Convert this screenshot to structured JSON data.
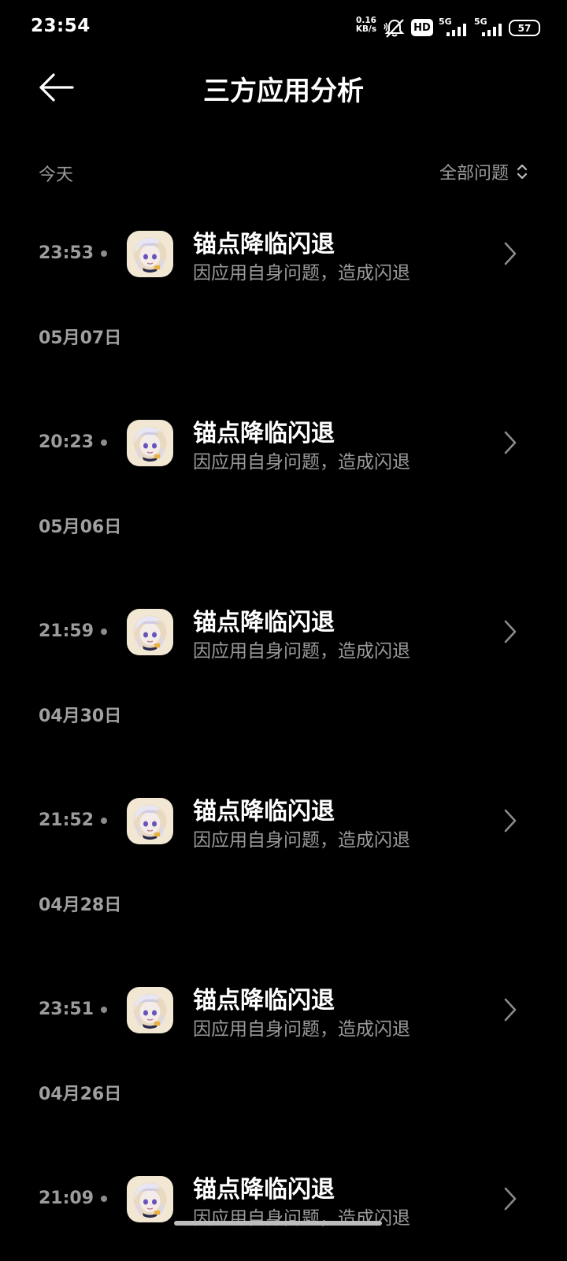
{
  "status_bar": {
    "time": "23:54",
    "net_speed_value": "0.16",
    "net_speed_unit": "KB/s",
    "hd_badge": "HD",
    "signal1_label": "5G",
    "signal2_label": "5G",
    "battery_level": "57",
    "icons": [
      "mute-icon",
      "hd-icon",
      "signal-5g-icon",
      "signal-5g-icon-2",
      "battery-icon"
    ]
  },
  "header": {
    "title": "三方应用分析",
    "back_icon": "back-arrow-icon"
  },
  "filter_row": {
    "section_label": "今天",
    "filter_label": "全部问题",
    "filter_icon": "sort-updown-icon"
  },
  "events": [
    {
      "date": "",
      "time": "23:53",
      "title": "锚点降临闪退",
      "subtitle": "因应用自身问题，造成闪退"
    },
    {
      "date": "05月07日",
      "time": "20:23",
      "title": "锚点降临闪退",
      "subtitle": "因应用自身问题，造成闪退"
    },
    {
      "date": "05月06日",
      "time": "21:59",
      "title": "锚点降临闪退",
      "subtitle": "因应用自身问题，造成闪退"
    },
    {
      "date": "04月30日",
      "time": "21:52",
      "title": "锚点降临闪退",
      "subtitle": "因应用自身问题，造成闪退"
    },
    {
      "date": "04月28日",
      "time": "23:51",
      "title": "锚点降临闪退",
      "subtitle": "因应用自身问题，造成闪退"
    },
    {
      "date": "04月26日",
      "time": "21:09",
      "title": "锚点降临闪退",
      "subtitle": "因应用自身问题，造成闪退"
    }
  ],
  "colors": {
    "background": "#000000",
    "primary_text": "#ffffff",
    "secondary_text": "#9a9a9a",
    "icon_bg": "#f2e7d3"
  }
}
